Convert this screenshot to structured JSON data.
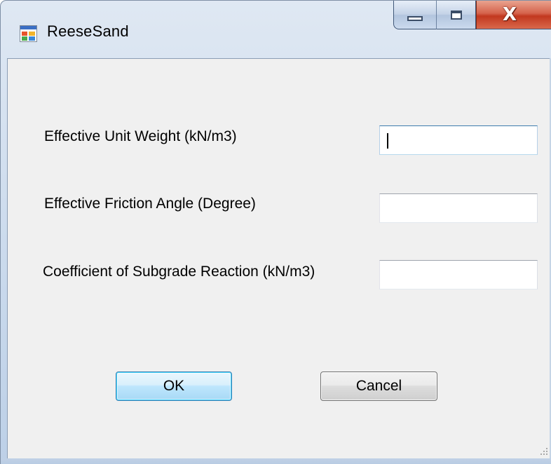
{
  "window": {
    "title": "ReeseSand",
    "icon": "windows-form-icon",
    "caption_buttons": {
      "minimize_icon": "minimize-icon",
      "maximize_icon": "maximize-icon",
      "close_icon": "close-icon",
      "close_glyph": "X"
    }
  },
  "form": {
    "fields": [
      {
        "label": "Effective Unit Weight (kN/m3)",
        "value": "",
        "focused": true
      },
      {
        "label": "Effective Friction Angle (Degree)",
        "value": "",
        "focused": false
      },
      {
        "label": "Coefficient of Subgrade Reaction (kN/m3)",
        "value": "",
        "focused": false
      }
    ],
    "buttons": {
      "ok_label": "OK",
      "cancel_label": "Cancel"
    }
  },
  "colors": {
    "client_background": "#f0f0f0",
    "close_button": "#c2381f",
    "ok_button_border": "#3c7fb1"
  }
}
